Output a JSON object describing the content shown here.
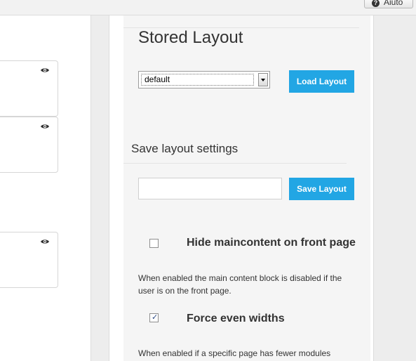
{
  "header": {
    "help_label": "Aiuto",
    "help_icon": "question-circle-icon"
  },
  "left_modules": [
    {
      "icon": "eye-icon"
    },
    {
      "icon": "eye-icon"
    },
    {
      "icon": "eye-icon"
    }
  ],
  "stored_layout": {
    "title": "Stored Layout",
    "select_value": "default",
    "load_button_label": "Load Layout"
  },
  "save_settings": {
    "title": "Save layout settings",
    "input_value": "",
    "input_placeholder": "",
    "save_button_label": "Save Layout"
  },
  "options": [
    {
      "label": "Hide maincontent on front page",
      "checked": false,
      "description": "When enabled the main content block is disabled if the user is on the front page."
    },
    {
      "label": "Force even widths",
      "checked": true,
      "description": "When enabled if a specific page has fewer modules"
    }
  ],
  "colors": {
    "accent": "#22a6e4",
    "panel_bg": "#f5f5f5"
  }
}
